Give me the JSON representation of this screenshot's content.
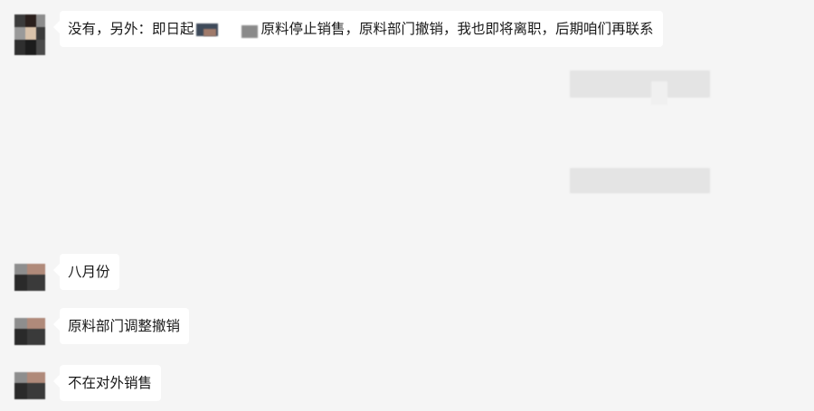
{
  "chat": {
    "messages": [
      {
        "sender": "contact",
        "text_before": "没有，另外：即日起",
        "text_after": "原料停止销售，原料部门撤销，我也即将离职，后期咱们再联系"
      },
      {
        "sender": "contact",
        "text": "八月份"
      },
      {
        "sender": "contact",
        "text": "原料部门调整撤销"
      },
      {
        "sender": "contact",
        "text": "不在对外销售"
      }
    ]
  },
  "colors": {
    "background": "#f5f5f5",
    "bubble": "#ffffff",
    "text": "#191919",
    "redaction_light": "#e4e4e4"
  }
}
